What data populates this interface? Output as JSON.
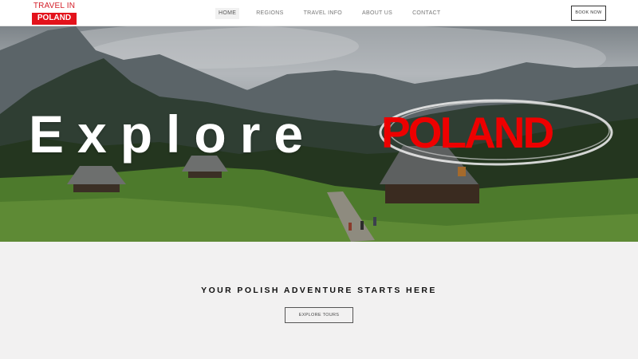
{
  "logo": {
    "top_text": "TRAVEL IN",
    "bottom_text": "POLAND"
  },
  "nav": {
    "items": [
      {
        "label": "HOME",
        "active": true
      },
      {
        "label": "REGIONS"
      },
      {
        "label": "TRAVEL INFO"
      },
      {
        "label": "ABOUT US"
      },
      {
        "label": "CONTACT"
      }
    ],
    "book_label": "BOOK NOW"
  },
  "hero": {
    "headline_1": "Explore",
    "headline_2": "POLAND"
  },
  "section": {
    "tagline": "YOUR POLISH ADVENTURE STARTS HERE",
    "button_label": "EXPLORE TOURS"
  },
  "colors": {
    "brand_red": "#e3121b",
    "logo_text_red": "#d4202a",
    "headline_white": "#ffffff",
    "section_bg": "#f2f1f1"
  }
}
